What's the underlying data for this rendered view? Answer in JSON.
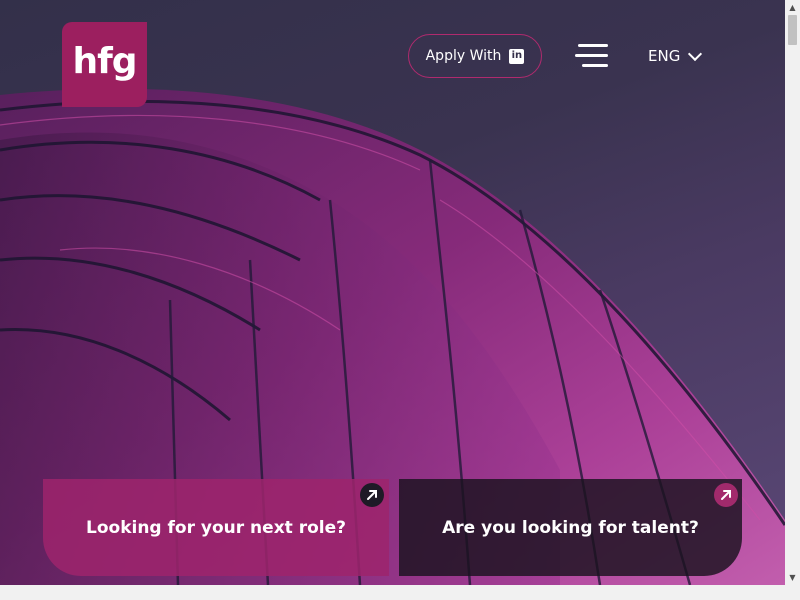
{
  "logo": {
    "text": "hfg"
  },
  "header": {
    "apply_label": "Apply With",
    "linkedin_icon": "linkedin-icon",
    "menu_icon": "hamburger-menu-icon",
    "language": "ENG",
    "language_icon": "chevron-down-icon"
  },
  "cards": [
    {
      "label": "Looking for your next role?",
      "icon": "arrow-up-right-icon"
    },
    {
      "label": "Are you looking for talent?",
      "icon": "arrow-up-right-icon"
    }
  ],
  "colors": {
    "brand_magenta": "#9c1f5f",
    "dark_card": "#1a121e",
    "hero_background": "#33304a"
  }
}
